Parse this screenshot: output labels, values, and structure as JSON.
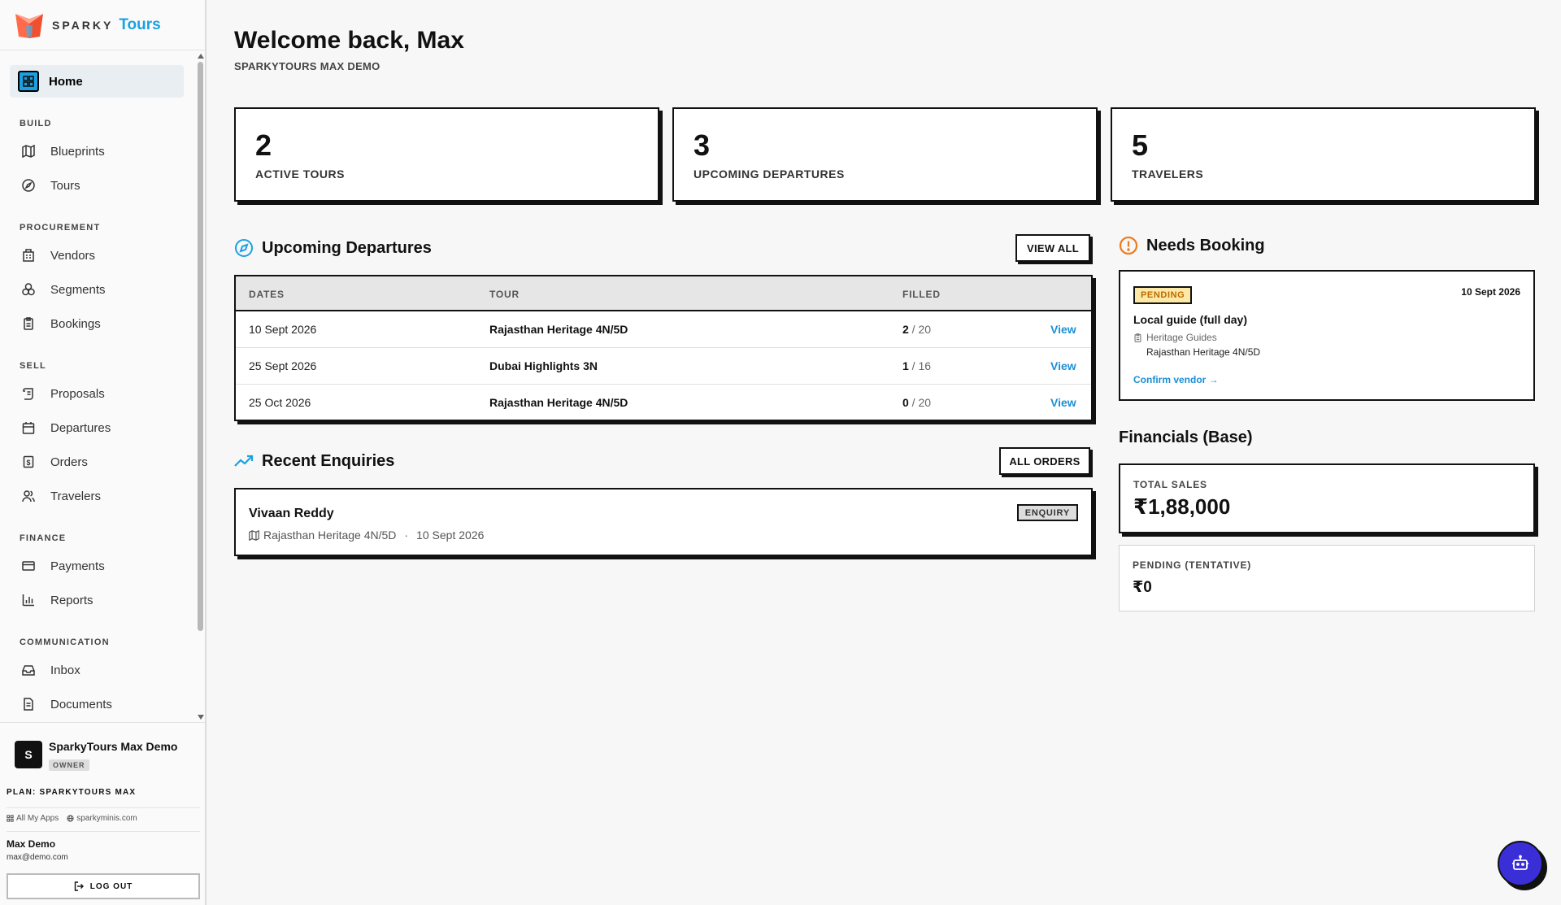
{
  "app": {
    "logo_word1": "SPARKY",
    "logo_word2": "Tours",
    "accent": "#1ba1e2"
  },
  "sidebar": {
    "home": "Home",
    "sections": [
      {
        "heading": "BUILD",
        "items": [
          "Blueprints",
          "Tours"
        ]
      },
      {
        "heading": "PROCUREMENT",
        "items": [
          "Vendors",
          "Segments",
          "Bookings"
        ]
      },
      {
        "heading": "SELL",
        "items": [
          "Proposals",
          "Departures",
          "Orders",
          "Travelers"
        ]
      },
      {
        "heading": "FINANCE",
        "items": [
          "Payments",
          "Reports"
        ]
      },
      {
        "heading": "COMMUNICATION",
        "items": [
          "Inbox",
          "Documents"
        ]
      }
    ],
    "org_initial": "S",
    "org_name": "SparkyTours Max Demo",
    "org_role": "OWNER",
    "plan": "PLAN: SPARKYTOURS MAX",
    "link_apps": "All My Apps",
    "link_site": "sparkyminis.com",
    "user_name": "Max Demo",
    "user_email": "max@demo.com",
    "logout": "LOG OUT"
  },
  "header": {
    "welcome": "Welcome back, Max",
    "subtitle": "SPARKYTOURS MAX DEMO"
  },
  "stats": [
    {
      "value": "2",
      "label": "ACTIVE TOURS"
    },
    {
      "value": "3",
      "label": "UPCOMING DEPARTURES"
    },
    {
      "value": "5",
      "label": "TRAVELERS"
    }
  ],
  "departures": {
    "title": "Upcoming Departures",
    "view_all": "VIEW ALL",
    "columns": [
      "DATES",
      "TOUR",
      "FILLED"
    ],
    "rows": [
      {
        "date": "10 Sept 2026",
        "tour": "Rajasthan Heritage 4N/5D",
        "filled": "2",
        "capacity": " / 20",
        "action": "View"
      },
      {
        "date": "25 Sept 2026",
        "tour": "Dubai Highlights 3N",
        "filled": "1",
        "capacity": " / 16",
        "action": "View"
      },
      {
        "date": "25 Oct 2026",
        "tour": "Rajasthan Heritage 4N/5D",
        "filled": "0",
        "capacity": " / 20",
        "action": "View"
      }
    ]
  },
  "enquiries": {
    "title": "Recent Enquiries",
    "all_orders": "ALL ORDERS",
    "items": [
      {
        "name": "Vivaan Reddy",
        "tour": "Rajasthan Heritage 4N/5D",
        "sep": "·",
        "date": "10 Sept 2026",
        "badge": "ENQUIRY"
      }
    ]
  },
  "needs_booking": {
    "title": "Needs Booking",
    "items": [
      {
        "badge": "PENDING",
        "date": "10 Sept 2026",
        "title": "Local guide (full day)",
        "vendor": "Heritage Guides",
        "tour": "Rajasthan Heritage 4N/5D",
        "link": "Confirm vendor →"
      }
    ]
  },
  "financials": {
    "title": "Financials (Base)",
    "total_sales_label": "TOTAL SALES",
    "total_sales_value": "₹1,88,000",
    "pending_label": "PENDING (TENTATIVE)",
    "pending_value": "₹0"
  }
}
